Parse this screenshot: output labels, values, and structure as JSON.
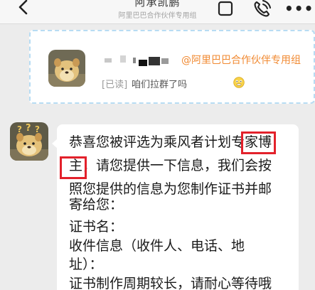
{
  "topbar": {
    "title": "阿承凯鹏",
    "subtitle": "阿里巴巴合作伙伴专用组",
    "more": "•••"
  },
  "pinned": {
    "mention": "@阿里巴巴合作伙伴专用组",
    "status": "[已读]",
    "text": "咱们拉群了吗"
  },
  "message": {
    "lines": [
      "恭喜您被评选为乘风者计划专家博",
      "主，请您提供一下信息，我们会按",
      "照您提供的信息为您制作证书并邮",
      "寄给您：",
      "证书名：",
      "收件信息（收件人、电话、地",
      "址）：",
      "证书制作周期较长，请耐心等待哦"
    ]
  },
  "colors": {
    "mention": "#f18a32",
    "highlight_box": "#e3212b",
    "card_border": "#b7dcf3",
    "background": "#ececec"
  },
  "icons": [
    "back-icon",
    "window-icon",
    "phone-icon",
    "more-icon",
    "emoji-icon"
  ]
}
